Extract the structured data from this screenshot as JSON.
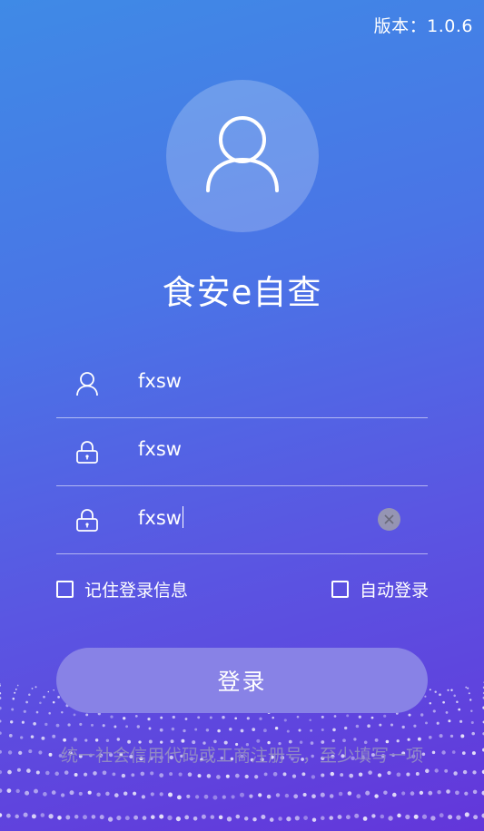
{
  "version_label": "版本：1.0.6",
  "app_title": "食安e自查",
  "fields": [
    {
      "icon": "user-icon",
      "value": "fxsw"
    },
    {
      "icon": "lock-icon",
      "value": "fxsw"
    },
    {
      "icon": "lock-icon",
      "value": "fxsw"
    }
  ],
  "options": {
    "remember_label": "记住登录信息",
    "auto_login_label": "自动登录"
  },
  "login_button_label": "登录",
  "hint_text": "统一社会信用代码或工商注册号，至少填写一项",
  "colors": {
    "background_top": "#3f8ae6",
    "background_bottom": "#6336da",
    "button": "#8882e6",
    "hint": "#8f88c4"
  }
}
